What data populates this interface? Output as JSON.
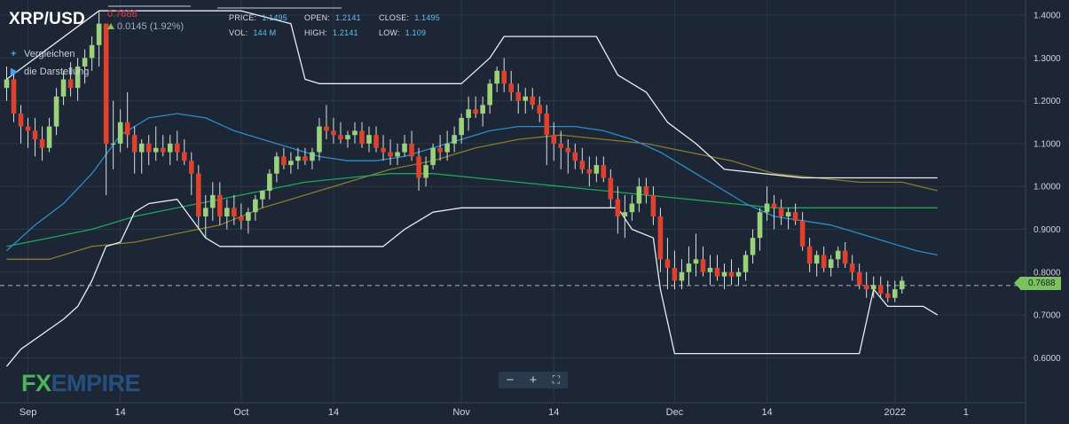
{
  "header": {
    "symbol": "XRP/USD",
    "last_price": "0.7688",
    "change": "0.0145 (1.92%)",
    "price_label": "PRICE:",
    "price_value": "1.1495",
    "open_label": "OPEN:",
    "open_value": "1.2141",
    "close_label": "CLOSE:",
    "close_value": "1.1495",
    "vol_label": "VOL:",
    "vol_value": "144 M",
    "high_label": "HIGH:",
    "high_value": "1.2141",
    "low_label": "LOW:",
    "low_value": "1.109"
  },
  "sidebar": {
    "compare_label": "Vergleichen",
    "display_label": "die Darstellung"
  },
  "logo": {
    "fx": "FX",
    "empire": "EMPIRE"
  },
  "zoom": {
    "minus": "−",
    "plus": "+",
    "fullscreen": "⛶"
  },
  "price_tag": "0.7688",
  "colors": {
    "background": "#1c2634",
    "grid": "#2c3848",
    "up_candle": "#9ad27c",
    "down_candle": "#e0412e",
    "donchian": "#e8edf2",
    "ma_fast": "#2e8bc9",
    "ma_mid": "#1fa45c",
    "ma_slow": "#8a7a2c",
    "price_line": "#aab4be"
  },
  "chart_data": {
    "type": "candlestick",
    "title": "XRP/USD",
    "ylim": [
      0.55,
      1.43
    ],
    "ytick_labels": [
      "1.4000",
      "1.3000",
      "1.2000",
      "1.1000",
      "1.0000",
      "0.9000",
      "0.8000",
      "0.7000",
      "0.6000"
    ],
    "ytick_values": [
      1.4,
      1.3,
      1.2,
      1.1,
      1.0,
      0.9,
      0.8,
      0.7,
      0.6
    ],
    "xtick_labels": [
      "Sep",
      "14",
      "Oct",
      "14",
      "Nov",
      "14",
      "Dec",
      "14",
      "2022",
      "1"
    ],
    "xtick_days": [
      3,
      16,
      33,
      46,
      64,
      77,
      94,
      107,
      125,
      135
    ],
    "current_price": 0.7688,
    "candles": {
      "start": 0,
      "step": 1,
      "ohlc": [
        [
          1.23,
          1.28,
          1.2,
          1.25
        ],
        [
          1.25,
          1.27,
          1.15,
          1.17
        ],
        [
          1.17,
          1.19,
          1.1,
          1.14
        ],
        [
          1.14,
          1.16,
          1.09,
          1.13
        ],
        [
          1.13,
          1.16,
          1.07,
          1.11
        ],
        [
          1.11,
          1.14,
          1.06,
          1.09
        ],
        [
          1.09,
          1.16,
          1.08,
          1.14
        ],
        [
          1.14,
          1.23,
          1.12,
          1.21
        ],
        [
          1.21,
          1.27,
          1.19,
          1.25
        ],
        [
          1.25,
          1.29,
          1.21,
          1.23
        ],
        [
          1.23,
          1.3,
          1.2,
          1.28
        ],
        [
          1.28,
          1.32,
          1.24,
          1.3
        ],
        [
          1.3,
          1.35,
          1.27,
          1.33
        ],
        [
          1.33,
          1.41,
          1.28,
          1.38
        ],
        [
          1.38,
          1.38,
          0.98,
          1.1
        ],
        [
          1.1,
          1.2,
          1.04,
          1.1
        ],
        [
          1.1,
          1.18,
          1.08,
          1.15
        ],
        [
          1.15,
          1.22,
          1.09,
          1.12
        ],
        [
          1.12,
          1.14,
          1.03,
          1.08
        ],
        [
          1.08,
          1.11,
          1.03,
          1.1
        ],
        [
          1.1,
          1.12,
          1.05,
          1.08
        ],
        [
          1.08,
          1.14,
          1.06,
          1.09
        ],
        [
          1.09,
          1.12,
          1.07,
          1.08
        ],
        [
          1.08,
          1.12,
          1.05,
          1.1
        ],
        [
          1.1,
          1.13,
          1.06,
          1.08
        ],
        [
          1.08,
          1.11,
          1.05,
          1.06
        ],
        [
          1.06,
          1.08,
          0.98,
          1.03
        ],
        [
          1.03,
          1.05,
          0.9,
          0.93
        ],
        [
          0.93,
          0.98,
          0.88,
          0.95
        ],
        [
          0.95,
          1.01,
          0.92,
          0.98
        ],
        [
          0.98,
          1.01,
          0.91,
          0.93
        ],
        [
          0.93,
          0.97,
          0.9,
          0.95
        ],
        [
          0.95,
          0.98,
          0.91,
          0.93
        ],
        [
          0.93,
          0.96,
          0.9,
          0.92
        ],
        [
          0.92,
          0.95,
          0.89,
          0.94
        ],
        [
          0.94,
          0.98,
          0.92,
          0.97
        ],
        [
          0.97,
          0.99,
          0.95,
          0.99
        ],
        [
          0.99,
          1.04,
          0.97,
          1.03
        ],
        [
          1.03,
          1.08,
          1.01,
          1.07
        ],
        [
          1.07,
          1.09,
          1.04,
          1.05
        ],
        [
          1.05,
          1.08,
          1.03,
          1.06
        ],
        [
          1.06,
          1.09,
          1.04,
          1.07
        ],
        [
          1.07,
          1.09,
          1.05,
          1.06
        ],
        [
          1.06,
          1.09,
          1.04,
          1.08
        ],
        [
          1.08,
          1.16,
          1.06,
          1.14
        ],
        [
          1.14,
          1.19,
          1.11,
          1.13
        ],
        [
          1.13,
          1.16,
          1.1,
          1.12
        ],
        [
          1.12,
          1.15,
          1.1,
          1.11
        ],
        [
          1.11,
          1.13,
          1.09,
          1.12
        ],
        [
          1.12,
          1.15,
          1.1,
          1.13
        ],
        [
          1.13,
          1.15,
          1.09,
          1.1
        ],
        [
          1.1,
          1.14,
          1.08,
          1.12
        ],
        [
          1.12,
          1.14,
          1.08,
          1.09
        ],
        [
          1.09,
          1.12,
          1.06,
          1.08
        ],
        [
          1.08,
          1.11,
          1.05,
          1.07
        ],
        [
          1.07,
          1.1,
          1.05,
          1.08
        ],
        [
          1.08,
          1.12,
          1.07,
          1.1
        ],
        [
          1.1,
          1.13,
          1.06,
          1.07
        ],
        [
          1.07,
          1.09,
          0.99,
          1.02
        ],
        [
          1.02,
          1.07,
          1.0,
          1.05
        ],
        [
          1.05,
          1.1,
          1.04,
          1.09
        ],
        [
          1.09,
          1.12,
          1.06,
          1.08
        ],
        [
          1.08,
          1.13,
          1.06,
          1.1
        ],
        [
          1.1,
          1.14,
          1.08,
          1.12
        ],
        [
          1.12,
          1.17,
          1.1,
          1.16
        ],
        [
          1.16,
          1.21,
          1.13,
          1.18
        ],
        [
          1.18,
          1.21,
          1.16,
          1.17
        ],
        [
          1.17,
          1.21,
          1.14,
          1.19
        ],
        [
          1.19,
          1.25,
          1.17,
          1.24
        ],
        [
          1.24,
          1.28,
          1.22,
          1.27
        ],
        [
          1.27,
          1.3,
          1.22,
          1.24
        ],
        [
          1.24,
          1.27,
          1.2,
          1.22
        ],
        [
          1.22,
          1.24,
          1.17,
          1.2
        ],
        [
          1.2,
          1.23,
          1.17,
          1.21
        ],
        [
          1.21,
          1.23,
          1.18,
          1.19
        ],
        [
          1.19,
          1.21,
          1.15,
          1.17
        ],
        [
          1.17,
          1.19,
          1.05,
          1.12
        ],
        [
          1.12,
          1.15,
          1.06,
          1.1
        ],
        [
          1.1,
          1.13,
          1.04,
          1.09
        ],
        [
          1.09,
          1.11,
          1.03,
          1.08
        ],
        [
          1.08,
          1.1,
          1.04,
          1.06
        ],
        [
          1.06,
          1.09,
          1.03,
          1.04
        ],
        [
          1.04,
          1.07,
          1.0,
          1.03
        ],
        [
          1.03,
          1.07,
          1.01,
          1.05
        ],
        [
          1.05,
          1.07,
          1.01,
          1.02
        ],
        [
          1.02,
          1.04,
          0.95,
          0.97
        ],
        [
          0.97,
          1.0,
          0.89,
          0.93
        ],
        [
          0.93,
          0.98,
          0.88,
          0.94
        ],
        [
          0.94,
          0.98,
          0.92,
          0.96
        ],
        [
          0.96,
          1.02,
          0.94,
          1.0
        ],
        [
          1.0,
          1.02,
          0.96,
          0.98
        ],
        [
          0.98,
          1.0,
          0.91,
          0.93
        ],
        [
          0.93,
          0.95,
          0.8,
          0.83
        ],
        [
          0.83,
          0.88,
          0.76,
          0.81
        ],
        [
          0.81,
          0.85,
          0.76,
          0.78
        ],
        [
          0.78,
          0.83,
          0.76,
          0.8
        ],
        [
          0.8,
          0.86,
          0.77,
          0.82
        ],
        [
          0.82,
          0.89,
          0.79,
          0.83
        ],
        [
          0.83,
          0.86,
          0.79,
          0.8
        ],
        [
          0.8,
          0.84,
          0.77,
          0.81
        ],
        [
          0.81,
          0.84,
          0.78,
          0.79
        ],
        [
          0.79,
          0.82,
          0.76,
          0.8
        ],
        [
          0.8,
          0.83,
          0.77,
          0.79
        ],
        [
          0.79,
          0.81,
          0.77,
          0.8
        ],
        [
          0.8,
          0.85,
          0.78,
          0.84
        ],
        [
          0.84,
          0.9,
          0.82,
          0.88
        ],
        [
          0.88,
          0.95,
          0.85,
          0.94
        ],
        [
          0.94,
          1.0,
          0.92,
          0.96
        ],
        [
          0.96,
          0.98,
          0.9,
          0.95
        ],
        [
          0.95,
          0.97,
          0.91,
          0.93
        ],
        [
          0.93,
          0.95,
          0.9,
          0.94
        ],
        [
          0.94,
          0.96,
          0.91,
          0.92
        ],
        [
          0.92,
          0.94,
          0.85,
          0.86
        ],
        [
          0.86,
          0.88,
          0.8,
          0.82
        ],
        [
          0.82,
          0.85,
          0.79,
          0.84
        ],
        [
          0.84,
          0.86,
          0.8,
          0.81
        ],
        [
          0.81,
          0.84,
          0.79,
          0.83
        ],
        [
          0.83,
          0.86,
          0.81,
          0.85
        ],
        [
          0.85,
          0.87,
          0.81,
          0.82
        ],
        [
          0.82,
          0.84,
          0.78,
          0.8
        ],
        [
          0.8,
          0.82,
          0.76,
          0.77
        ],
        [
          0.77,
          0.8,
          0.74,
          0.76
        ],
        [
          0.76,
          0.79,
          0.74,
          0.77
        ],
        [
          0.77,
          0.79,
          0.74,
          0.75
        ],
        [
          0.75,
          0.78,
          0.73,
          0.74
        ],
        [
          0.74,
          0.78,
          0.73,
          0.76
        ],
        [
          0.76,
          0.79,
          0.75,
          0.78
        ]
      ]
    },
    "donchian_upper": [
      [
        0,
        1.25
      ],
      [
        13,
        1.41
      ],
      [
        14,
        1.41
      ],
      [
        31,
        1.41
      ],
      [
        33,
        1.41
      ],
      [
        40,
        1.38
      ],
      [
        42,
        1.25
      ],
      [
        44,
        1.24
      ],
      [
        64,
        1.24
      ],
      [
        66,
        1.27
      ],
      [
        68,
        1.3
      ],
      [
        70,
        1.35
      ],
      [
        79,
        1.35
      ],
      [
        83,
        1.35
      ],
      [
        84,
        1.32
      ],
      [
        86,
        1.26
      ],
      [
        90,
        1.22
      ],
      [
        93,
        1.15
      ],
      [
        97,
        1.1
      ],
      [
        101,
        1.04
      ],
      [
        112,
        1.02
      ],
      [
        131,
        1.02
      ]
    ],
    "donchian_lower": [
      [
        0,
        0.58
      ],
      [
        2,
        0.62
      ],
      [
        8,
        0.69
      ],
      [
        10,
        0.72
      ],
      [
        12,
        0.78
      ],
      [
        14,
        0.86
      ],
      [
        16,
        0.87
      ],
      [
        18,
        0.94
      ],
      [
        20,
        0.96
      ],
      [
        24,
        0.97
      ],
      [
        28,
        0.88
      ],
      [
        30,
        0.86
      ],
      [
        40,
        0.86
      ],
      [
        44,
        0.86
      ],
      [
        53,
        0.86
      ],
      [
        56,
        0.9
      ],
      [
        60,
        0.94
      ],
      [
        64,
        0.95
      ],
      [
        68,
        0.95
      ],
      [
        78,
        0.95
      ],
      [
        86,
        0.95
      ],
      [
        88,
        0.9
      ],
      [
        91,
        0.88
      ],
      [
        92,
        0.76
      ],
      [
        94,
        0.61
      ],
      [
        120,
        0.61
      ],
      [
        122,
        0.76
      ],
      [
        124,
        0.72
      ],
      [
        129,
        0.72
      ],
      [
        131,
        0.7
      ]
    ],
    "ma_fast": [
      [
        0,
        0.85
      ],
      [
        4,
        0.91
      ],
      [
        8,
        0.96
      ],
      [
        12,
        1.03
      ],
      [
        16,
        1.12
      ],
      [
        20,
        1.16
      ],
      [
        24,
        1.17
      ],
      [
        28,
        1.16
      ],
      [
        32,
        1.13
      ],
      [
        36,
        1.11
      ],
      [
        40,
        1.09
      ],
      [
        44,
        1.07
      ],
      [
        48,
        1.06
      ],
      [
        52,
        1.06
      ],
      [
        56,
        1.07
      ],
      [
        60,
        1.09
      ],
      [
        64,
        1.11
      ],
      [
        68,
        1.13
      ],
      [
        72,
        1.14
      ],
      [
        76,
        1.14
      ],
      [
        80,
        1.14
      ],
      [
        84,
        1.13
      ],
      [
        88,
        1.11
      ],
      [
        92,
        1.08
      ],
      [
        96,
        1.04
      ],
      [
        100,
        1.0
      ],
      [
        104,
        0.96
      ],
      [
        108,
        0.93
      ],
      [
        112,
        0.92
      ],
      [
        116,
        0.91
      ],
      [
        120,
        0.89
      ],
      [
        124,
        0.87
      ],
      [
        128,
        0.85
      ],
      [
        131,
        0.84
      ]
    ],
    "ma_mid": [
      [
        0,
        0.86
      ],
      [
        6,
        0.88
      ],
      [
        12,
        0.9
      ],
      [
        18,
        0.93
      ],
      [
        24,
        0.95
      ],
      [
        30,
        0.97
      ],
      [
        36,
        0.99
      ],
      [
        42,
        1.01
      ],
      [
        48,
        1.02
      ],
      [
        54,
        1.03
      ],
      [
        60,
        1.03
      ],
      [
        66,
        1.02
      ],
      [
        72,
        1.01
      ],
      [
        78,
        1.0
      ],
      [
        84,
        0.99
      ],
      [
        90,
        0.98
      ],
      [
        96,
        0.97
      ],
      [
        102,
        0.96
      ],
      [
        108,
        0.95
      ],
      [
        114,
        0.95
      ],
      [
        120,
        0.95
      ],
      [
        126,
        0.95
      ],
      [
        131,
        0.95
      ]
    ],
    "ma_slow": [
      [
        0,
        0.83
      ],
      [
        6,
        0.83
      ],
      [
        12,
        0.86
      ],
      [
        18,
        0.87
      ],
      [
        24,
        0.89
      ],
      [
        30,
        0.91
      ],
      [
        36,
        0.95
      ],
      [
        42,
        0.98
      ],
      [
        48,
        1.01
      ],
      [
        54,
        1.04
      ],
      [
        60,
        1.06
      ],
      [
        66,
        1.09
      ],
      [
        72,
        1.11
      ],
      [
        78,
        1.12
      ],
      [
        84,
        1.11
      ],
      [
        90,
        1.1
      ],
      [
        96,
        1.08
      ],
      [
        102,
        1.06
      ],
      [
        108,
        1.03
      ],
      [
        114,
        1.02
      ],
      [
        120,
        1.01
      ],
      [
        126,
        1.01
      ],
      [
        131,
        0.99
      ]
    ]
  }
}
